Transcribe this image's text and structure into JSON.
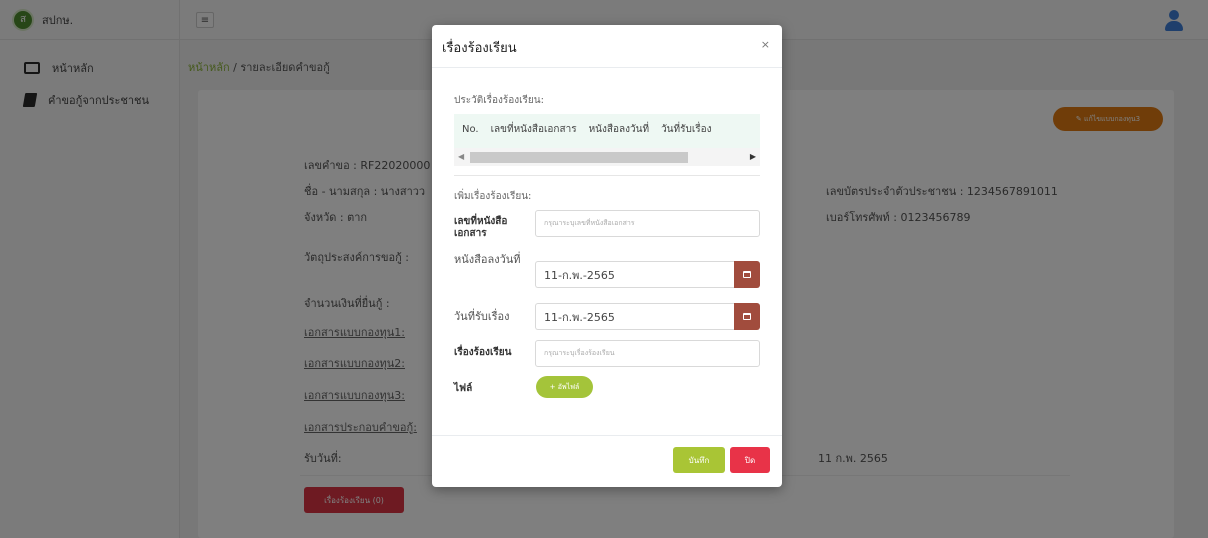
{
  "sidebar": {
    "brand_name": "สปกษ.",
    "brand_logo": "ส",
    "items": [
      {
        "label": "หน้าหลัก",
        "icon": "list-icon"
      },
      {
        "label": "คำขอกู้จากประชาชน",
        "icon": "book-icon"
      }
    ]
  },
  "topbar": {
    "menu_icon": "≡"
  },
  "breadcrumb": {
    "home": "หน้าหลัก",
    "separator": " / ",
    "current": "รายละเอียดคำขอกู้"
  },
  "detail": {
    "print_button": "✎ แก้ไขแบบกองทุน3",
    "request_no": "เลขคำขอ :  RF22020000",
    "name": "ชื่อ - นามสกุล :  นางสาวว",
    "province": "จังหวัด :  ตาก",
    "purpose": "วัตถุประสงค์การขอกู้ :",
    "amount": "จำนวนเงินที่ยื่นกู้ :",
    "doc1": "เอกสารแบบกองทุน1:",
    "doc2": "เอกสารแบบกองทุน2:",
    "doc3": "เอกสารแบบกองทุน3:",
    "doc_attach": "เอกสารประกอบคำขอกู้:",
    "received_label": "รับวันที่:",
    "id_card": "เลขบัตรประจำตัวประชาชน :  1234567891011",
    "phone": "เบอร์โทรศัพท์ :  0123456789",
    "received_date": "11 ก.พ. 2565",
    "complaint_button": "เรื่องร้องเรียน (0)"
  },
  "modal": {
    "title": "เรื่องร้องเรียน",
    "close": "×",
    "history_label": "ประวัติเรื่องร้องเรียน:",
    "table_headers": [
      "No.",
      "เลขที่หนังสือเอกสาร",
      "หนังสือลงวันที่",
      "วันที่รับเรื่อง"
    ],
    "add_label": "เพิ่มเรื่องร้องเรียน:",
    "doc_no_label": "เลขที่หนังสือเอกสาร",
    "doc_no_placeholder": "กรุณาระบุเลขที่หนังสือเอกสาร",
    "doc_date_label": "หนังสือลงวันที่",
    "doc_date_value": "11-ก.พ.-2565",
    "received_label": "วันที่รับเรื่อง",
    "received_value": "11-ก.พ.-2565",
    "subject_label": "เรื่องร้องเรียน",
    "subject_placeholder": "กรุณาระบุเรื่องร้องเรียน",
    "file_label": "ไฟล์",
    "file_button": "+ อัพไฟล์",
    "save_button": "บันทึก",
    "cancel_button": "ปิด"
  },
  "colors": {
    "accent_green": "#a9c535",
    "danger": "#e83348",
    "orange": "#e07b12",
    "calendar": "#a14c3d",
    "user_icon": "#3f7fd8"
  }
}
